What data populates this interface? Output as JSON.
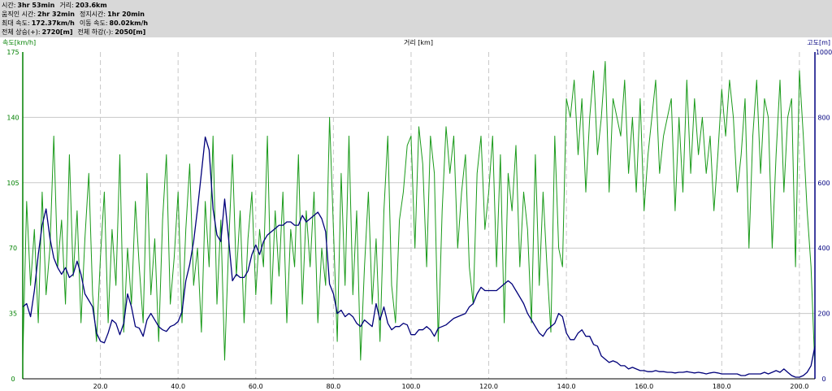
{
  "stats": {
    "rows": [
      [
        {
          "label": "시간:",
          "value": "3hr 53min"
        },
        {
          "label": "거리:",
          "value": "203.6km"
        }
      ],
      [
        {
          "label": "움직인 시간:",
          "value": "2hr 32min"
        },
        {
          "label": "정지시간:",
          "value": "1hr 20min"
        }
      ],
      [
        {
          "label": "최대 속도:",
          "value": "172.37km/h"
        },
        {
          "label": "이동 속도:",
          "value": "80.02km/h"
        }
      ],
      [
        {
          "label": "전체 상승(+):",
          "value": "2720[m]"
        },
        {
          "label": "전체 하강(-):",
          "value": "2050[m]"
        }
      ]
    ]
  },
  "chart_data": {
    "type": "line",
    "xlabel": "거리 [km]",
    "ylabel_left": "속도[km/h]",
    "ylabel_right": "고도[m]",
    "xlim": [
      0,
      204
    ],
    "ylim_left": [
      0,
      175
    ],
    "ylim_right": [
      0,
      1000
    ],
    "xticks": [
      "20.0",
      "40.0",
      "60.0",
      "80.0",
      "100.0",
      "120.0",
      "140.0",
      "160.0",
      "180.0",
      "200.0"
    ],
    "yticks_left": [
      "0",
      "35",
      "70",
      "105",
      "140",
      "175"
    ],
    "yticks_right": [
      "0",
      "200",
      "400",
      "600",
      "800",
      "1000"
    ],
    "grid": true,
    "colors": {
      "speed": "#1a9a1a",
      "altitude": "#00007a",
      "left_axis": "#008000",
      "right_axis": "#000080",
      "grid": "#c8c8c8"
    },
    "series": [
      {
        "key": "speed",
        "axis": "left",
        "x": [
          0,
          1,
          2,
          3,
          4,
          5,
          6,
          7,
          8,
          9,
          10,
          11,
          12,
          13,
          14,
          15,
          16,
          17,
          18,
          19,
          20,
          21,
          22,
          23,
          24,
          25,
          26,
          27,
          28,
          29,
          30,
          31,
          32,
          33,
          34,
          35,
          36,
          37,
          38,
          39,
          40,
          41,
          42,
          43,
          44,
          45,
          46,
          47,
          48,
          49,
          50,
          51,
          52,
          53,
          54,
          55,
          56,
          57,
          58,
          59,
          60,
          61,
          62,
          63,
          64,
          65,
          66,
          67,
          68,
          69,
          70,
          71,
          72,
          73,
          74,
          75,
          76,
          77,
          78,
          79,
          80,
          81,
          82,
          83,
          84,
          85,
          86,
          87,
          88,
          89,
          90,
          91,
          92,
          93,
          94,
          95,
          96,
          97,
          98,
          99,
          100,
          101,
          102,
          103,
          104,
          105,
          106,
          107,
          108,
          109,
          110,
          111,
          112,
          113,
          114,
          115,
          116,
          117,
          118,
          119,
          120,
          121,
          122,
          123,
          124,
          125,
          126,
          127,
          128,
          129,
          130,
          131,
          132,
          133,
          134,
          135,
          136,
          137,
          138,
          139,
          140,
          141,
          142,
          143,
          144,
          145,
          146,
          147,
          148,
          149,
          150,
          151,
          152,
          153,
          154,
          155,
          156,
          157,
          158,
          159,
          160,
          161,
          162,
          163,
          164,
          165,
          166,
          167,
          168,
          169,
          170,
          171,
          172,
          173,
          174,
          175,
          176,
          177,
          178,
          179,
          180,
          181,
          182,
          183,
          184,
          185,
          186,
          187,
          188,
          189,
          190,
          191,
          192,
          193,
          194,
          195,
          196,
          197,
          198,
          199,
          200,
          201,
          202,
          203,
          204
        ],
        "values": [
          10,
          95,
          50,
          80,
          30,
          100,
          45,
          70,
          130,
          60,
          85,
          40,
          120,
          55,
          90,
          30,
          75,
          110,
          45,
          20,
          65,
          100,
          30,
          80,
          50,
          120,
          25,
          70,
          40,
          95,
          60,
          30,
          110,
          45,
          75,
          20,
          85,
          120,
          40,
          65,
          100,
          30,
          80,
          115,
          50,
          70,
          25,
          95,
          60,
          130,
          40,
          85,
          10,
          70,
          120,
          55,
          90,
          30,
          75,
          100,
          45,
          80,
          60,
          130,
          40,
          90,
          55,
          100,
          30,
          80,
          60,
          120,
          40,
          90,
          60,
          100,
          30,
          70,
          50,
          140,
          80,
          20,
          110,
          50,
          130,
          45,
          90,
          10,
          60,
          100,
          40,
          75,
          20,
          90,
          130,
          50,
          30,
          85,
          100,
          125,
          130,
          70,
          135,
          115,
          60,
          130,
          110,
          20,
          90,
          135,
          110,
          130,
          70,
          100,
          120,
          60,
          40,
          110,
          130,
          80,
          100,
          130,
          60,
          120,
          30,
          110,
          90,
          125,
          60,
          100,
          80,
          30,
          120,
          50,
          100,
          60,
          25,
          130,
          70,
          60,
          150,
          140,
          160,
          120,
          150,
          100,
          140,
          165,
          120,
          140,
          170,
          100,
          150,
          140,
          130,
          160,
          110,
          140,
          100,
          150,
          90,
          120,
          140,
          160,
          110,
          130,
          140,
          150,
          90,
          140,
          100,
          160,
          110,
          150,
          120,
          140,
          110,
          130,
          90,
          120,
          155,
          130,
          160,
          140,
          100,
          120,
          150,
          70,
          130,
          160,
          110,
          150,
          140,
          70,
          120,
          160,
          100,
          140,
          150,
          60,
          165,
          130,
          90,
          60,
          5
        ]
      },
      {
        "key": "altitude",
        "axis": "right",
        "x": [
          0,
          1,
          2,
          3,
          4,
          5,
          6,
          7,
          8,
          9,
          10,
          11,
          12,
          13,
          14,
          15,
          16,
          17,
          18,
          19,
          20,
          21,
          22,
          23,
          24,
          25,
          26,
          27,
          28,
          29,
          30,
          31,
          32,
          33,
          34,
          35,
          36,
          37,
          38,
          39,
          40,
          41,
          42,
          43,
          44,
          45,
          46,
          47,
          48,
          49,
          50,
          51,
          52,
          53,
          54,
          55,
          56,
          57,
          58,
          59,
          60,
          61,
          62,
          63,
          64,
          65,
          66,
          67,
          68,
          69,
          70,
          71,
          72,
          73,
          74,
          75,
          76,
          77,
          78,
          79,
          80,
          81,
          82,
          83,
          84,
          85,
          86,
          87,
          88,
          89,
          90,
          91,
          92,
          93,
          94,
          95,
          96,
          97,
          98,
          99,
          100,
          101,
          102,
          103,
          104,
          105,
          106,
          107,
          108,
          109,
          110,
          111,
          112,
          113,
          114,
          115,
          116,
          117,
          118,
          119,
          120,
          121,
          122,
          123,
          124,
          125,
          126,
          127,
          128,
          129,
          130,
          131,
          132,
          133,
          134,
          135,
          136,
          137,
          138,
          139,
          140,
          141,
          142,
          143,
          144,
          145,
          146,
          147,
          148,
          149,
          150,
          151,
          152,
          153,
          154,
          155,
          156,
          157,
          158,
          159,
          160,
          161,
          162,
          163,
          164,
          165,
          166,
          167,
          168,
          169,
          170,
          171,
          172,
          173,
          174,
          175,
          176,
          177,
          178,
          179,
          180,
          181,
          182,
          183,
          184,
          185,
          186,
          187,
          188,
          189,
          190,
          191,
          192,
          193,
          194,
          195,
          196,
          197,
          198,
          199,
          200,
          201,
          202,
          203,
          204
        ],
        "values": [
          220,
          230,
          190,
          270,
          380,
          470,
          520,
          430,
          370,
          340,
          320,
          340,
          310,
          320,
          360,
          320,
          260,
          240,
          220,
          140,
          115,
          110,
          140,
          180,
          170,
          135,
          170,
          260,
          220,
          160,
          155,
          130,
          180,
          200,
          180,
          160,
          150,
          145,
          160,
          165,
          175,
          205,
          300,
          350,
          420,
          520,
          630,
          740,
          700,
          520,
          440,
          420,
          550,
          430,
          300,
          320,
          310,
          310,
          330,
          380,
          410,
          380,
          420,
          440,
          450,
          460,
          470,
          470,
          480,
          480,
          470,
          470,
          500,
          480,
          490,
          500,
          510,
          490,
          450,
          290,
          260,
          200,
          210,
          190,
          200,
          190,
          170,
          160,
          180,
          170,
          160,
          230,
          180,
          220,
          170,
          150,
          160,
          160,
          170,
          165,
          135,
          135,
          150,
          150,
          160,
          150,
          130,
          155,
          160,
          165,
          175,
          185,
          190,
          195,
          200,
          220,
          230,
          260,
          280,
          270,
          270,
          270,
          270,
          280,
          290,
          300,
          290,
          270,
          250,
          230,
          200,
          180,
          160,
          140,
          130,
          150,
          160,
          170,
          200,
          190,
          140,
          120,
          120,
          140,
          150,
          130,
          130,
          105,
          100,
          70,
          60,
          50,
          55,
          50,
          40,
          40,
          30,
          35,
          30,
          25,
          25,
          22,
          22,
          25,
          22,
          22,
          20,
          20,
          18,
          20,
          20,
          22,
          20,
          18,
          20,
          18,
          15,
          18,
          20,
          18,
          15,
          15,
          15,
          15,
          15,
          10,
          10,
          15,
          15,
          15,
          15,
          20,
          15,
          20,
          25,
          20,
          30,
          20,
          10,
          5,
          5,
          10,
          20,
          40,
          100
        ]
      }
    ]
  }
}
